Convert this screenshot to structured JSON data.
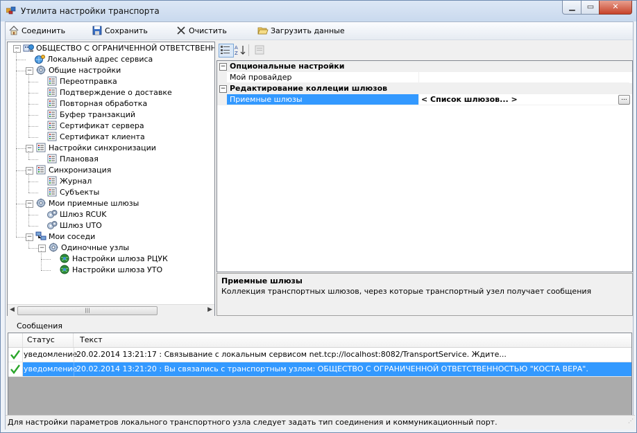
{
  "window": {
    "title": "Утилита настройки транспорта"
  },
  "toolbar": {
    "connect_label": "Соединить",
    "save_label": "Сохранить",
    "clear_label": "Очистить",
    "load_label": "Загрузить данные"
  },
  "tree": {
    "items": [
      {
        "label": "ОБЩЕСТВО С ОГРАНИЧЕННОЙ ОТВЕТСТВЕННО",
        "icon": "org-icon"
      },
      {
        "label": "Локальный адрес сервиса",
        "icon": "globe-gear-icon"
      },
      {
        "label": "Общие настройки",
        "icon": "gear-icon"
      },
      {
        "label": "Переотправка",
        "icon": "list-icon"
      },
      {
        "label": "Подтверждение о доставке",
        "icon": "list-icon"
      },
      {
        "label": "Повторная обработка",
        "icon": "list-icon"
      },
      {
        "label": "Буфер транзакций",
        "icon": "list-icon"
      },
      {
        "label": "Сертификат сервера",
        "icon": "list-icon"
      },
      {
        "label": "Сертификат клиента",
        "icon": "list-icon"
      },
      {
        "label": "Настройки синхронизации",
        "icon": "list-icon"
      },
      {
        "label": "Плановая",
        "icon": "list-icon"
      },
      {
        "label": "Синхронизация",
        "icon": "list-icon"
      },
      {
        "label": "Журнал",
        "icon": "list-icon"
      },
      {
        "label": "Субъекты",
        "icon": "list-icon"
      },
      {
        "label": "Мои приемные шлюзы",
        "icon": "gear-icon"
      },
      {
        "label": "Шлюз RCUK",
        "icon": "gears-icon"
      },
      {
        "label": "Шлюз UTO",
        "icon": "gears-icon"
      },
      {
        "label": "Мои соседи",
        "icon": "network-icon"
      },
      {
        "label": "Одиночные узлы",
        "icon": "gear-icon"
      },
      {
        "label": "Настройки шлюза РЦУК",
        "icon": "globe-icon"
      },
      {
        "label": "Настройки шлюза УТО",
        "icon": "globe-icon"
      }
    ]
  },
  "property_grid": {
    "category1": "Опциональные настройки",
    "prop1_name": "Мой провайдер",
    "prop1_value": "",
    "category2": "Редактирование коллеции шлюзов",
    "prop2_name": "Приемные шлюзы",
    "prop2_value": "< Список шлюзов... >",
    "ellipsis_label": "...",
    "description_title": "Приемные шлюзы",
    "description_text": "Коллекция транспортных шлюзов, через которые транспортный узел получает сообщения"
  },
  "messages": {
    "title": "Сообщения",
    "col_status": "Статус",
    "col_text": "Текст",
    "rows": [
      {
        "status": "уведомление",
        "text": "20.02.2014 13:21:17 : Связывание с локальным сервисом net.tcp://localhost:8082/TransportService. Ждите..."
      },
      {
        "status": "уведомление",
        "text": "20.02.2014 13:21:20 : Вы связались с транспортным узлом: ОБЩЕСТВО С ОГРАНИЧЕННОЙ ОТВЕТСТВЕННОСТЬЮ \"КОСТА ВЕРА\"."
      }
    ]
  },
  "status_bar": {
    "text": "Для настройки параметров локального транспортного узла следует задать тип соединения и коммуникационный порт."
  },
  "colors": {
    "selection": "#3399ff",
    "titlebar": "#c9d9ee"
  }
}
